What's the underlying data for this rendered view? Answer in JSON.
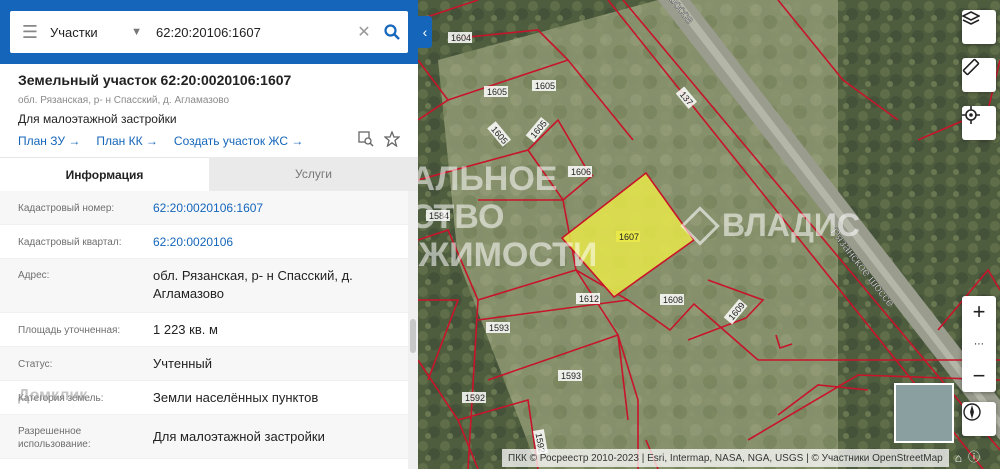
{
  "search": {
    "layer": "Участки",
    "query": "62:20:20106:1607"
  },
  "parcel": {
    "title": "Земельный участок 62:20:0020106:1607",
    "address_short": "обл. Рязанская, р- н Спасский, д. Агламазово",
    "purpose": "Для малоэтажной застройки",
    "links": [
      "План ЗУ →",
      "План КК →",
      "Создать участок ЖС →"
    ]
  },
  "tabs": [
    "Информация",
    "Услуги"
  ],
  "rows": [
    {
      "key": "Кадастровый номер:",
      "value": "62:20:0020106:1607",
      "link": true
    },
    {
      "key": "Кадастровый квартал:",
      "value": "62:20:0020106",
      "link": true
    },
    {
      "key": "Адрес:",
      "value": "обл. Рязанская, р- н Спасский, д. Агламазово",
      "link": false
    },
    {
      "key": "Площадь уточненная:",
      "value": "1 223 кв. м",
      "link": false
    },
    {
      "key": "Статус:",
      "value": "Учтенный",
      "link": false
    },
    {
      "key": "Категория земель:",
      "value": "Земли населённых пунктов",
      "link": false
    },
    {
      "key": "Разрешенное использование:",
      "value": "Для малоэтажной застройки",
      "link": false
    }
  ],
  "map": {
    "road_name": "Рязанское шоссе",
    "road_name_top": "шоссе",
    "parcel_labels": [
      "1604",
      "1605",
      "1605",
      "1605",
      "1605",
      "1606",
      "1607",
      "1584",
      "1612",
      "1608",
      "1609",
      "1593",
      "1593",
      "1592",
      "1592",
      "137"
    ],
    "attribution": "ПКК © Росреестр 2010-2023 | Esri, Intermap, NASA, NGA, USGS | © Участники OpenStreetMap",
    "watermark_1": "ЦЕНТРАЛЬНОЕ",
    "watermark_2": "АГЕНТСТВО",
    "watermark_3": "НЕДВИЖИМОСТИ",
    "watermark_brand": "ВЛАДИС",
    "watermark_domclick": "Домклик"
  },
  "colors": {
    "brand_blue": "#1566bb",
    "parcel_highlight": "#e8e84a",
    "boundary_red": "#c8142a"
  },
  "icons": [
    "menu-icon",
    "chevron-down-icon",
    "close-icon",
    "search-icon",
    "chevron-left-icon",
    "layers-icon",
    "ruler-icon",
    "locate-icon",
    "plus-icon",
    "minus-icon",
    "compass-icon",
    "home-icon"
  ]
}
